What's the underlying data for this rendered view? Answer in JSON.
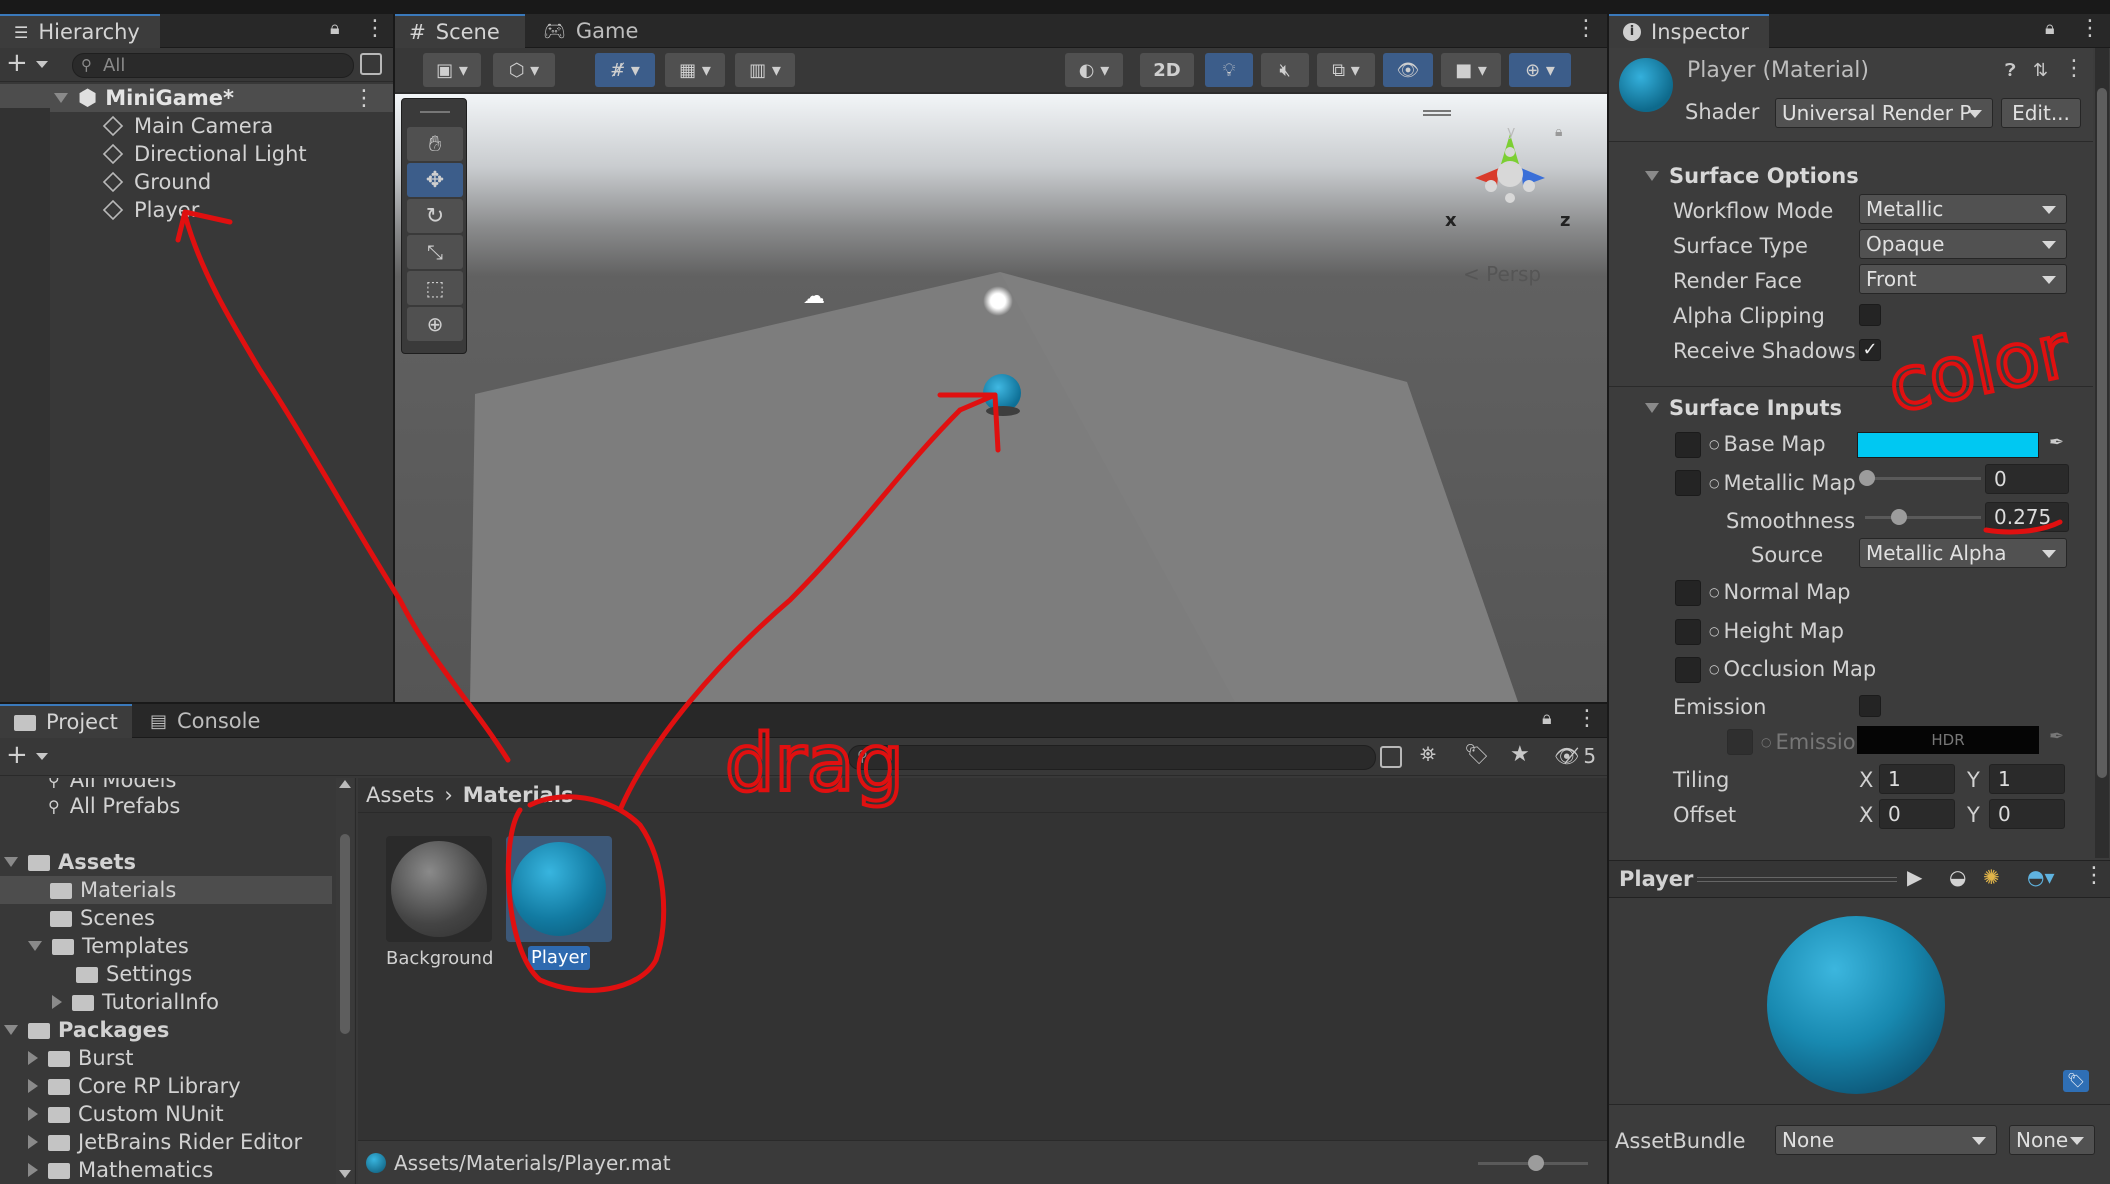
{
  "hierarchy": {
    "tab_label": "Hierarchy",
    "search_placeholder": "All",
    "scene_name": "MiniGame*",
    "objects": [
      "Main Camera",
      "Directional Light",
      "Ground",
      "Player"
    ]
  },
  "scene_view": {
    "tabs": [
      "Scene",
      "Game"
    ],
    "toolbar_2d": "2D",
    "persp_label": "Persp",
    "gizmo_axes": {
      "x": "x",
      "y": "y",
      "z": "z"
    }
  },
  "inspector": {
    "tab_label": "Inspector",
    "title": "Player (Material)",
    "shader_label": "Shader",
    "shader_value": "Universal Render P",
    "edit_button": "Edit...",
    "surface_options": {
      "header": "Surface Options",
      "workflow_mode_label": "Workflow Mode",
      "workflow_mode_value": "Metallic",
      "surface_type_label": "Surface Type",
      "surface_type_value": "Opaque",
      "render_face_label": "Render Face",
      "render_face_value": "Front",
      "alpha_clipping_label": "Alpha Clipping",
      "receive_shadows_label": "Receive Shadows",
      "receive_shadows_checked": true
    },
    "surface_inputs": {
      "header": "Surface Inputs",
      "base_map_label": "Base Map",
      "base_color": "#00c8f2",
      "metallic_map_label": "Metallic Map",
      "metallic_value": "0",
      "smoothness_label": "Smoothness",
      "smoothness_value": "0.275",
      "smoothness_fraction": 0.275,
      "source_label": "Source",
      "source_value": "Metallic Alpha",
      "normal_map_label": "Normal Map",
      "height_map_label": "Height Map",
      "occlusion_map_label": "Occlusion Map",
      "emission_label": "Emission",
      "emission_map_label": "Emission",
      "hdr_label": "HDR",
      "tiling_label": "Tiling",
      "offset_label": "Offset",
      "tiling_x": "1",
      "tiling_y": "1",
      "offset_x": "0",
      "offset_y": "0",
      "x_label": "X",
      "y_label": "Y"
    },
    "preview_title": "Player",
    "assetbundle_label": "AssetBundle",
    "assetbundle_value": "None",
    "assetbundle_variant": "None"
  },
  "project": {
    "tabs": [
      "Project",
      "Console"
    ],
    "hidden_count": "5",
    "sidebar": {
      "partial_item": "All Models",
      "all_prefabs": "All Prefabs",
      "assets": "Assets",
      "asset_children": [
        "Materials",
        "Scenes",
        "Templates"
      ],
      "template_children": [
        "Settings",
        "TutorialInfo"
      ],
      "packages": "Packages",
      "package_children": [
        "Burst",
        "Core RP Library",
        "Custom NUnit",
        "JetBrains Rider Editor",
        "Mathematics"
      ]
    },
    "breadcrumb": [
      "Assets",
      "Materials"
    ],
    "assets": [
      {
        "name": "Background",
        "selected": false
      },
      {
        "name": "Player",
        "selected": true
      }
    ],
    "status_path": "Assets/Materials/Player.mat"
  },
  "annotations": {
    "drag_text": "drag",
    "color_text": "color",
    "ink_color": "#e01010"
  },
  "colors": {
    "accent": "#3a79bb",
    "player_blue": "#1f8fb5"
  }
}
